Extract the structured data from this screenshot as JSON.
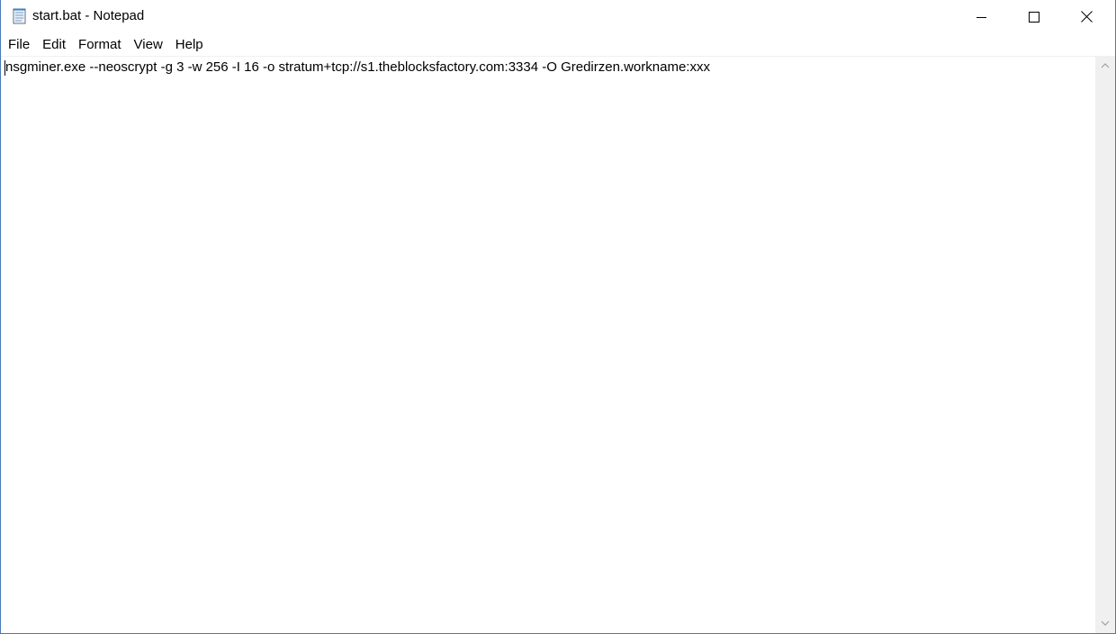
{
  "window": {
    "title": "start.bat - Notepad",
    "app_icon": "notepad-icon",
    "controls": {
      "minimize_icon": "minimize-icon",
      "maximize_icon": "maximize-icon",
      "close_icon": "close-icon"
    }
  },
  "menu": {
    "items": [
      {
        "label": "File"
      },
      {
        "label": "Edit"
      },
      {
        "label": "Format"
      },
      {
        "label": "View"
      },
      {
        "label": "Help"
      }
    ]
  },
  "editor": {
    "content": "nsgminer.exe --neoscrypt -g 3 -w 256 -I 16 -o stratum+tcp://s1.theblocksfactory.com:3334 -O Gredirzen.workname:xxx"
  },
  "scrollbar": {
    "up_icon": "scroll-up-arrow-icon",
    "down_icon": "scroll-down-arrow-icon"
  },
  "colors": {
    "window_border": "#4a7ab8",
    "scrollbar_track": "#f0f0f0",
    "text": "#000000"
  }
}
